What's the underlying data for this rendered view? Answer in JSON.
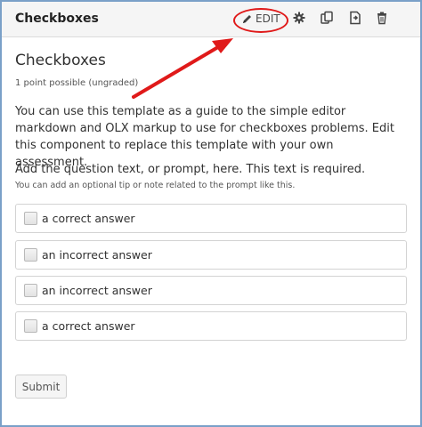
{
  "header": {
    "title": "Checkboxes",
    "edit_label": "EDIT",
    "tools": [
      {
        "icon": "gear-icon"
      },
      {
        "icon": "duplicate-icon"
      },
      {
        "icon": "move-icon"
      },
      {
        "icon": "delete-icon"
      }
    ]
  },
  "problem": {
    "title": "Checkboxes",
    "points": "1 point possible (ungraded)",
    "description": "You can use this template as a guide to the simple editor markdown and OLX markup to use for checkboxes problems. Edit this component to replace this template with your own assessment.",
    "prompt": "Add the question text, or prompt, here. This text is required.",
    "tip": "You can add an optional tip or note related to the prompt like this.",
    "choices": [
      {
        "label": "a correct answer",
        "checked": false
      },
      {
        "label": "an incorrect answer",
        "checked": false
      },
      {
        "label": "an incorrect answer",
        "checked": false
      },
      {
        "label": "a correct answer",
        "checked": false
      }
    ],
    "submit_label": "Submit"
  },
  "colors": {
    "annotation": "#e01a1a",
    "frame_border": "#7aa0c8",
    "header_bg": "#f5f5f5"
  }
}
